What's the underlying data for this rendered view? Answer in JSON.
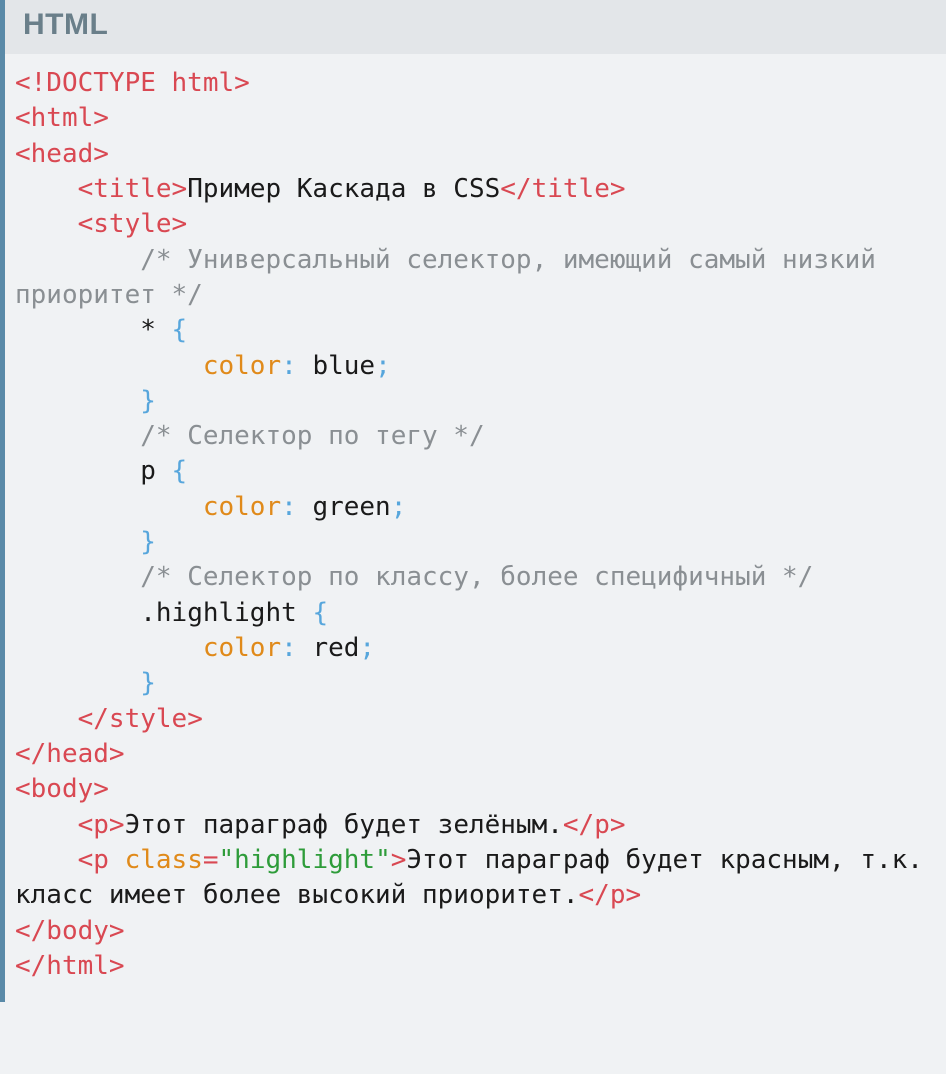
{
  "header": {
    "label": "HTML"
  },
  "code": {
    "tokens": [
      {
        "cls": "t-tag",
        "text": "<!DOCTYPE html>"
      },
      {
        "cls": "",
        "text": "\n"
      },
      {
        "cls": "t-tag",
        "text": "<html>"
      },
      {
        "cls": "",
        "text": "\n"
      },
      {
        "cls": "t-tag",
        "text": "<head>"
      },
      {
        "cls": "",
        "text": "\n"
      },
      {
        "cls": "",
        "text": "    "
      },
      {
        "cls": "t-tag",
        "text": "<title>"
      },
      {
        "cls": "t-plain",
        "text": "Пример Каскада в CSS"
      },
      {
        "cls": "t-tag",
        "text": "</title>"
      },
      {
        "cls": "",
        "text": "\n"
      },
      {
        "cls": "",
        "text": "    "
      },
      {
        "cls": "t-tag",
        "text": "<style>"
      },
      {
        "cls": "",
        "text": "\n"
      },
      {
        "cls": "",
        "text": "        "
      },
      {
        "cls": "t-comm",
        "text": "/* Универсальный селектор, имеющий самый низкий приоритет */"
      },
      {
        "cls": "",
        "text": "\n"
      },
      {
        "cls": "",
        "text": "        "
      },
      {
        "cls": "t-plain",
        "text": "*"
      },
      {
        "cls": "",
        "text": " "
      },
      {
        "cls": "t-punc",
        "text": "{"
      },
      {
        "cls": "",
        "text": "\n"
      },
      {
        "cls": "",
        "text": "            "
      },
      {
        "cls": "t-attr",
        "text": "color"
      },
      {
        "cls": "t-punc",
        "text": ":"
      },
      {
        "cls": "",
        "text": " "
      },
      {
        "cls": "t-plain",
        "text": "blue"
      },
      {
        "cls": "t-punc",
        "text": ";"
      },
      {
        "cls": "",
        "text": "\n"
      },
      {
        "cls": "",
        "text": "        "
      },
      {
        "cls": "t-punc",
        "text": "}"
      },
      {
        "cls": "",
        "text": "\n"
      },
      {
        "cls": "",
        "text": "        "
      },
      {
        "cls": "t-comm",
        "text": "/* Селектор по тегу */"
      },
      {
        "cls": "",
        "text": "\n"
      },
      {
        "cls": "",
        "text": "        "
      },
      {
        "cls": "t-plain",
        "text": "p"
      },
      {
        "cls": "",
        "text": " "
      },
      {
        "cls": "t-punc",
        "text": "{"
      },
      {
        "cls": "",
        "text": "\n"
      },
      {
        "cls": "",
        "text": "            "
      },
      {
        "cls": "t-attr",
        "text": "color"
      },
      {
        "cls": "t-punc",
        "text": ":"
      },
      {
        "cls": "",
        "text": " "
      },
      {
        "cls": "t-plain",
        "text": "green"
      },
      {
        "cls": "t-punc",
        "text": ";"
      },
      {
        "cls": "",
        "text": "\n"
      },
      {
        "cls": "",
        "text": "        "
      },
      {
        "cls": "t-punc",
        "text": "}"
      },
      {
        "cls": "",
        "text": "\n"
      },
      {
        "cls": "",
        "text": "        "
      },
      {
        "cls": "t-comm",
        "text": "/* Селектор по классу, более специфичный */"
      },
      {
        "cls": "",
        "text": "\n"
      },
      {
        "cls": "",
        "text": "        "
      },
      {
        "cls": "t-plain",
        "text": ".highlight"
      },
      {
        "cls": "",
        "text": " "
      },
      {
        "cls": "t-punc",
        "text": "{"
      },
      {
        "cls": "",
        "text": "\n"
      },
      {
        "cls": "",
        "text": "            "
      },
      {
        "cls": "t-attr",
        "text": "color"
      },
      {
        "cls": "t-punc",
        "text": ":"
      },
      {
        "cls": "",
        "text": " "
      },
      {
        "cls": "t-plain",
        "text": "red"
      },
      {
        "cls": "t-punc",
        "text": ";"
      },
      {
        "cls": "",
        "text": "\n"
      },
      {
        "cls": "",
        "text": "        "
      },
      {
        "cls": "t-punc",
        "text": "}"
      },
      {
        "cls": "",
        "text": "\n"
      },
      {
        "cls": "",
        "text": "    "
      },
      {
        "cls": "t-tag",
        "text": "</style>"
      },
      {
        "cls": "",
        "text": "\n"
      },
      {
        "cls": "t-tag",
        "text": "</head>"
      },
      {
        "cls": "",
        "text": "\n"
      },
      {
        "cls": "t-tag",
        "text": "<body>"
      },
      {
        "cls": "",
        "text": "\n"
      },
      {
        "cls": "",
        "text": "    "
      },
      {
        "cls": "t-tag",
        "text": "<p>"
      },
      {
        "cls": "t-plain",
        "text": "Этот параграф будет зелёным."
      },
      {
        "cls": "t-tag",
        "text": "</p>"
      },
      {
        "cls": "",
        "text": "\n"
      },
      {
        "cls": "",
        "text": "    "
      },
      {
        "cls": "t-tag",
        "text": "<p "
      },
      {
        "cls": "t-attr",
        "text": "class"
      },
      {
        "cls": "t-tag",
        "text": "="
      },
      {
        "cls": "t-str",
        "text": "\"highlight\""
      },
      {
        "cls": "t-tag",
        "text": ">"
      },
      {
        "cls": "t-plain",
        "text": "Этот параграф будет красным, т.к. класс имеет более высокий приоритет."
      },
      {
        "cls": "t-tag",
        "text": "</p>"
      },
      {
        "cls": "",
        "text": "\n"
      },
      {
        "cls": "t-tag",
        "text": "</body>"
      },
      {
        "cls": "",
        "text": "\n"
      },
      {
        "cls": "t-tag",
        "text": "</html>"
      }
    ]
  }
}
